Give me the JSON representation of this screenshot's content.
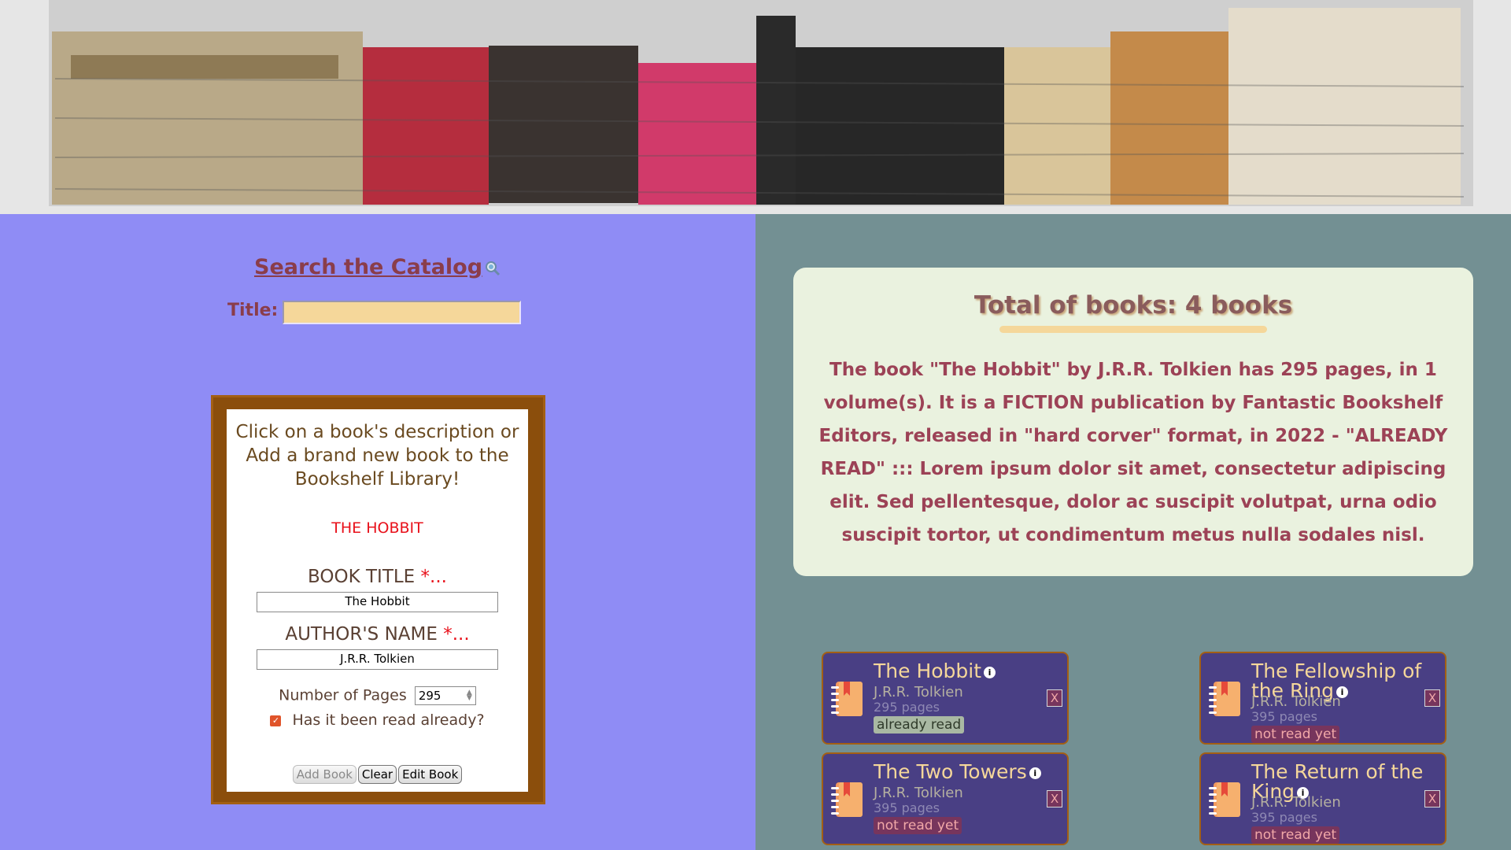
{
  "search": {
    "heading": "Search the Catalog",
    "title_label": "Title:",
    "title_value": ""
  },
  "form": {
    "intro": "Click on a book's description or Add a brand new book to the Bookshelf Library!",
    "selected_title": "THE HOBBIT",
    "book_title_label": "BOOK TITLE",
    "author_label": "AUTHOR'S NAME",
    "required_marker": "*...",
    "book_title_value": "The Hobbit",
    "author_value": "J.R.R. Tolkien",
    "pages_label": "Number of Pages",
    "pages_value": "295",
    "read_label": "Has it been read already?",
    "read_checked": true,
    "buttons": {
      "add": "Add Book",
      "clear": "Clear",
      "edit": "Edit Book"
    }
  },
  "summary": {
    "total": "Total of books: 4 books",
    "description": "The book \"The Hobbit\" by J.R.R. Tolkien has 295 pages, in 1 volume(s). It is a FICTION publication by Fantastic Bookshelf Editors, released in \"hard corver\" format, in 2022 - \"ALREADY READ\" ::: Lorem ipsum dolor sit amet, consectetur adipiscing elit. Sed pellentesque, dolor ac suscipit volutpat, urna odio suscipit tortor, ut condimentum metus nulla sodales nisl."
  },
  "books": [
    {
      "title": "The Hobbit",
      "author": "J.R.R. Tolkien",
      "pages": "295 pages",
      "status": "already read",
      "read": true,
      "delete": "X",
      "info": "i"
    },
    {
      "title": "The Fellowship of the Ring",
      "author": "J.R.R. Tolkien",
      "pages": "395 pages",
      "status": "not read yet",
      "read": false,
      "delete": "X",
      "info": "i"
    },
    {
      "title": "The Two Towers",
      "author": "J.R.R. Tolkien",
      "pages": "395 pages",
      "status": "not read yet",
      "read": false,
      "delete": "X",
      "info": "i"
    },
    {
      "title": "The Return of the King",
      "author": "J.R.R. Tolkien",
      "pages": "395 pages",
      "status": "not read yet",
      "read": false,
      "delete": "X",
      "info": "i"
    }
  ],
  "colors": {
    "left_bg": "#8f8cf5",
    "right_bg": "#739093",
    "card_bg": "#493f84",
    "accent": "#f5d79a",
    "heading": "#8a3d4a"
  }
}
